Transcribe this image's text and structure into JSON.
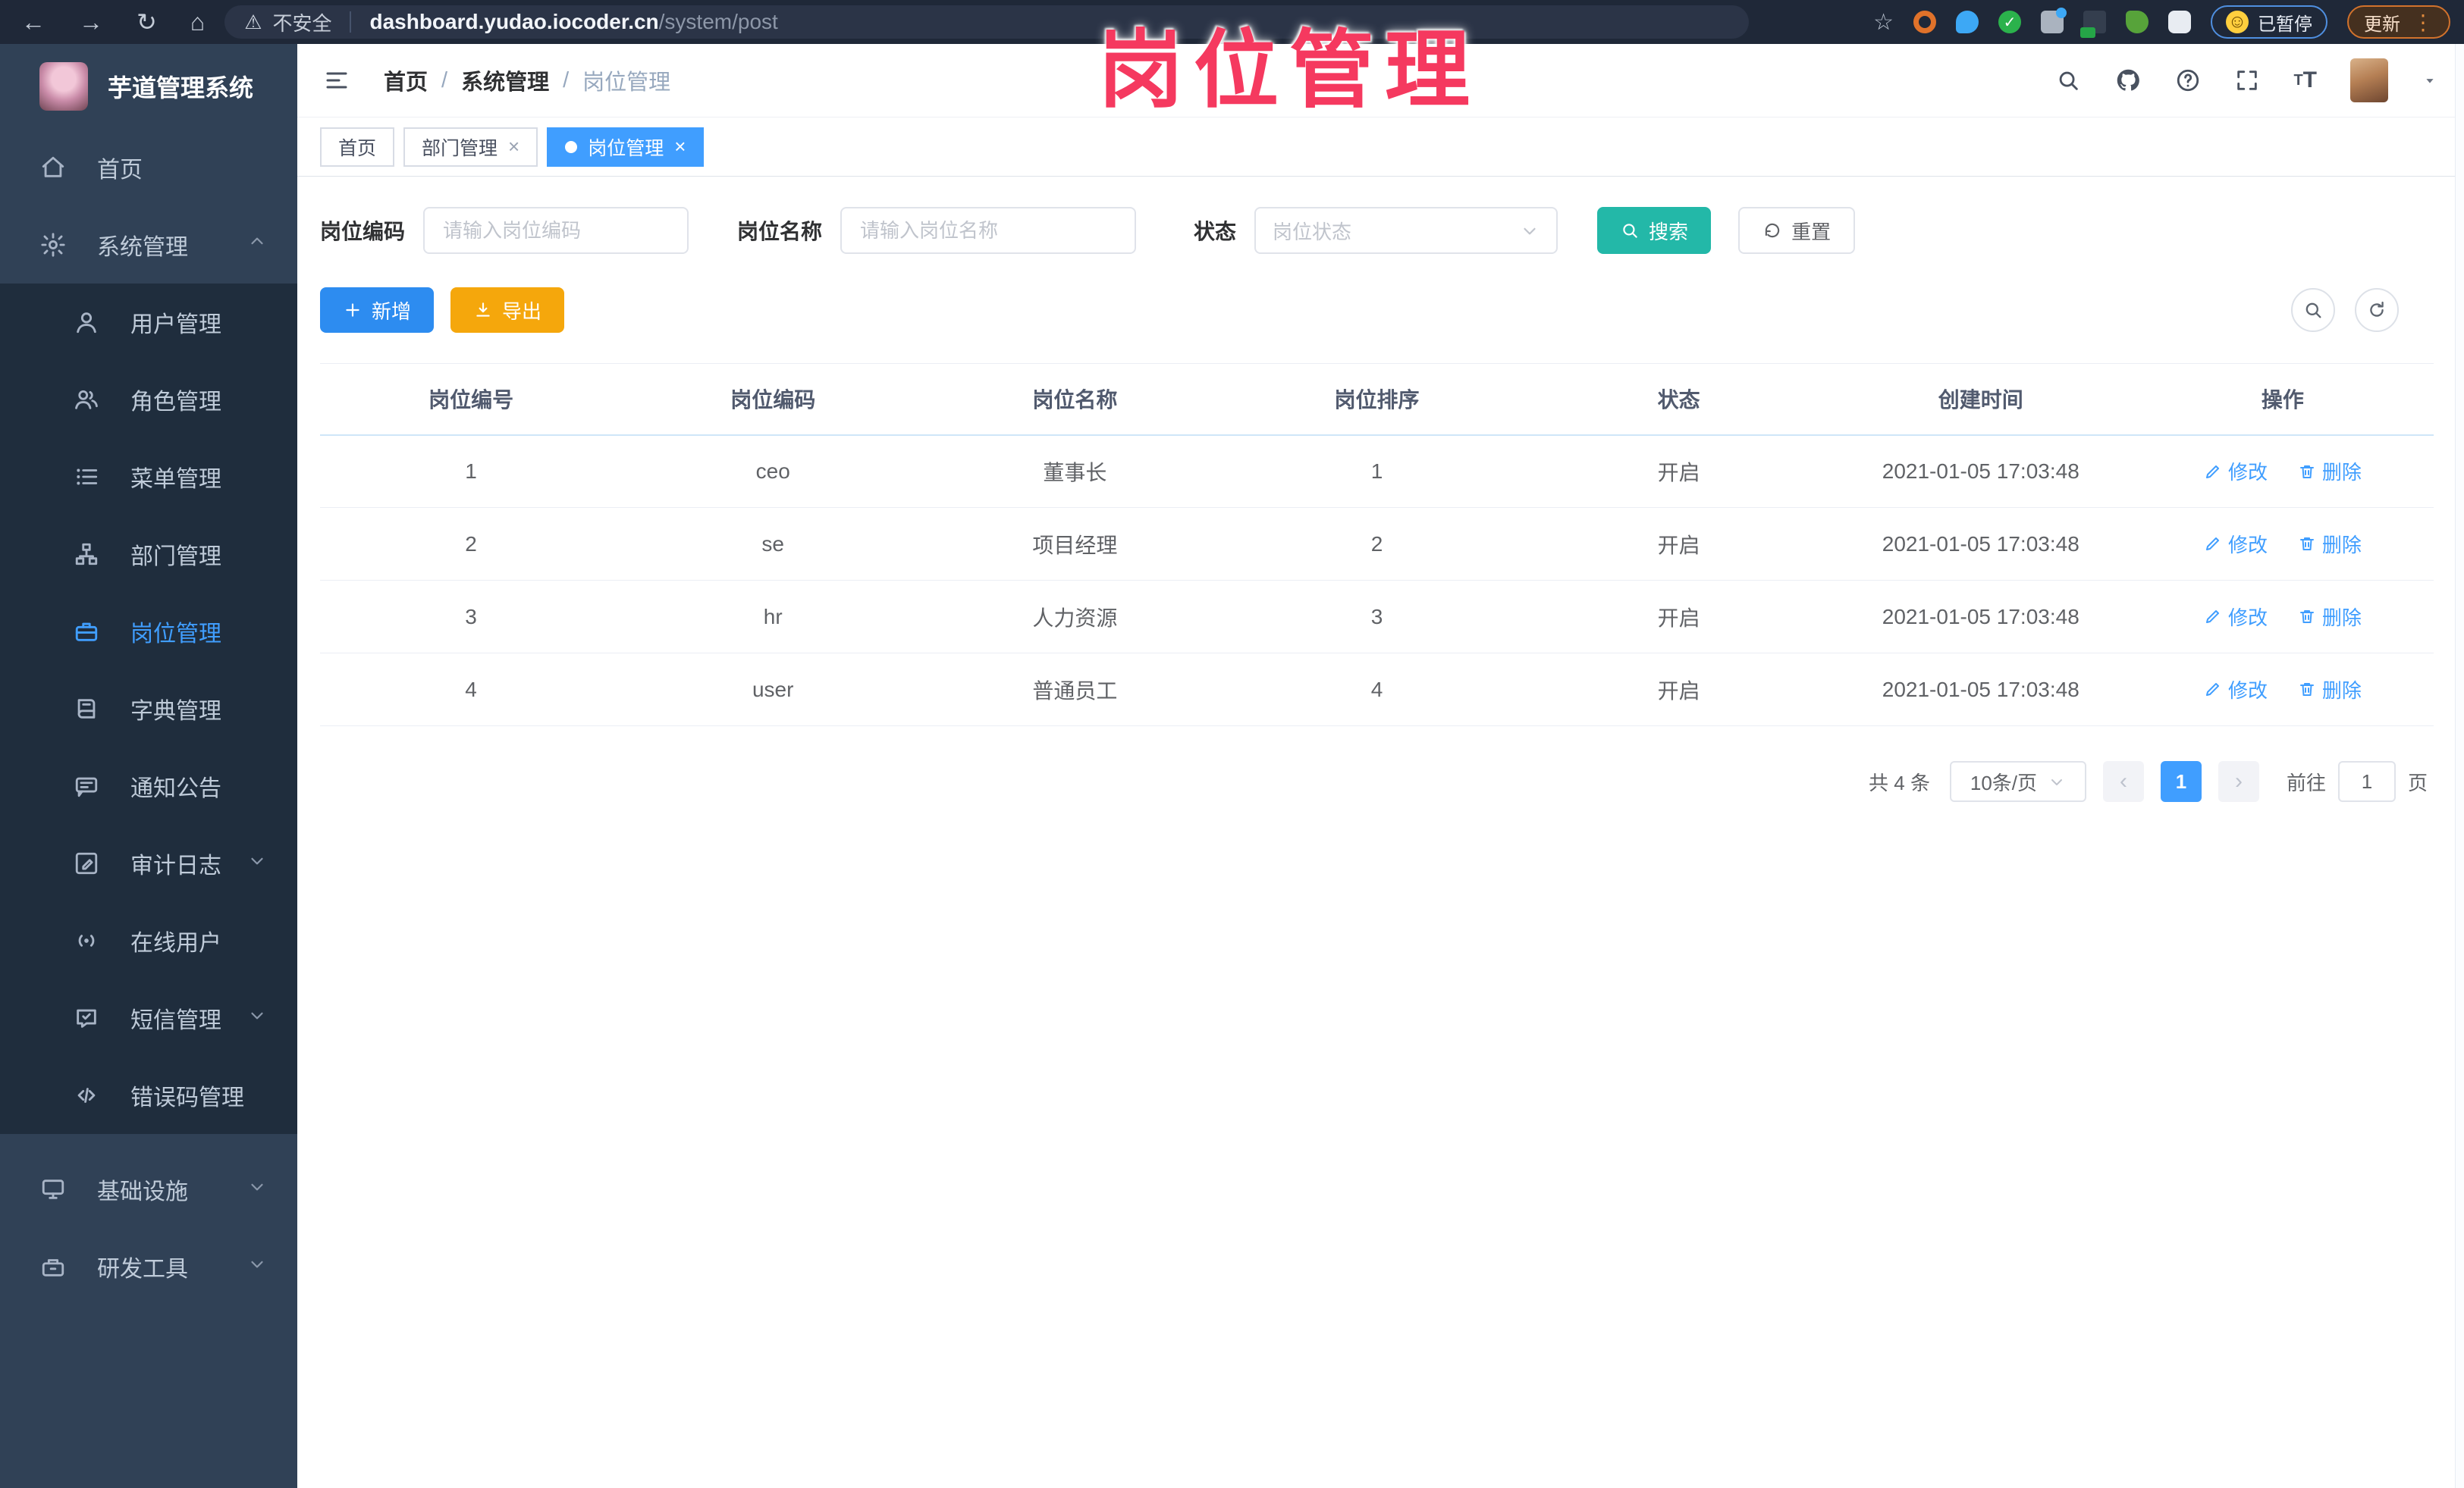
{
  "browser": {
    "security_label": "不安全",
    "url_domain": "dashboard.yudao.iocoder.cn",
    "url_path": "/system/post",
    "paused_badge": "已暂停",
    "update_button": "更新"
  },
  "icons": {
    "back": "←",
    "forward": "→",
    "reload": "↻",
    "home": "⌂",
    "star": "☆",
    "warning": "⚠",
    "smiley": "☺",
    "kebab": "⋮",
    "close": "×",
    "prev": "‹",
    "next": "›",
    "breadcrumb_sep": "/",
    "font_big": "T",
    "font_small": "T"
  },
  "overlay": {
    "title": "岗位管理"
  },
  "theme": {
    "primary": "#409EFF",
    "search_button": "#23b8a8",
    "add_button": "#2d8cf0",
    "export_button": "#f5a70c",
    "overlay_text": "#f5395f",
    "sidebar_bg": "#304156",
    "submenu_bg": "#1f2d3d"
  },
  "sidebar": {
    "app_name": "芋道管理系统",
    "items": [
      {
        "label": "首页",
        "icon": "home-icon"
      },
      {
        "label": "系统管理",
        "icon": "gear-icon"
      },
      {
        "label": "用户管理",
        "icon": "user-icon"
      },
      {
        "label": "角色管理",
        "icon": "users-icon"
      },
      {
        "label": "菜单管理",
        "icon": "menu-list-icon"
      },
      {
        "label": "部门管理",
        "icon": "org-tree-icon"
      },
      {
        "label": "岗位管理",
        "icon": "briefcase-icon"
      },
      {
        "label": "字典管理",
        "icon": "book-icon"
      },
      {
        "label": "通知公告",
        "icon": "announcement-icon"
      },
      {
        "label": "审计日志",
        "icon": "audit-log-icon"
      },
      {
        "label": "在线用户",
        "icon": "online-signal-icon"
      },
      {
        "label": "短信管理",
        "icon": "sms-icon"
      },
      {
        "label": "错误码管理",
        "icon": "code-icon"
      },
      {
        "label": "基础设施",
        "icon": "infrastructure-icon"
      },
      {
        "label": "研发工具",
        "icon": "devtools-icon"
      }
    ]
  },
  "breadcrumb": [
    "首页",
    "系统管理",
    "岗位管理"
  ],
  "tabs": [
    {
      "label": "首页",
      "closable": false,
      "active": false
    },
    {
      "label": "部门管理",
      "closable": true,
      "active": false
    },
    {
      "label": "岗位管理",
      "closable": true,
      "active": true
    }
  ],
  "filters": {
    "post_code_label": "岗位编码",
    "post_code_placeholder": "请输入岗位编码",
    "post_name_label": "岗位名称",
    "post_name_placeholder": "请输入岗位名称",
    "status_label": "状态",
    "status_placeholder": "岗位状态",
    "search_label": "搜索",
    "reset_label": "重置"
  },
  "toolbar": {
    "add_label": "新增",
    "export_label": "导出"
  },
  "table": {
    "columns": [
      "岗位编号",
      "岗位编码",
      "岗位名称",
      "岗位排序",
      "状态",
      "创建时间",
      "操作"
    ],
    "rows": [
      {
        "id": "1",
        "code": "ceo",
        "name": "董事长",
        "sort": "1",
        "status": "开启",
        "created": "2021-01-05 17:03:48"
      },
      {
        "id": "2",
        "code": "se",
        "name": "项目经理",
        "sort": "2",
        "status": "开启",
        "created": "2021-01-05 17:03:48"
      },
      {
        "id": "3",
        "code": "hr",
        "name": "人力资源",
        "sort": "3",
        "status": "开启",
        "created": "2021-01-05 17:03:48"
      },
      {
        "id": "4",
        "code": "user",
        "name": "普通员工",
        "sort": "4",
        "status": "开启",
        "created": "2021-01-05 17:03:48"
      }
    ],
    "actions": {
      "edit": "修改",
      "delete": "删除"
    }
  },
  "pagination": {
    "total": "共 4 条",
    "page_size": "10条/页",
    "current_page": "1",
    "goto_label": "前往",
    "goto_value": "1",
    "page_suffix": "页"
  }
}
